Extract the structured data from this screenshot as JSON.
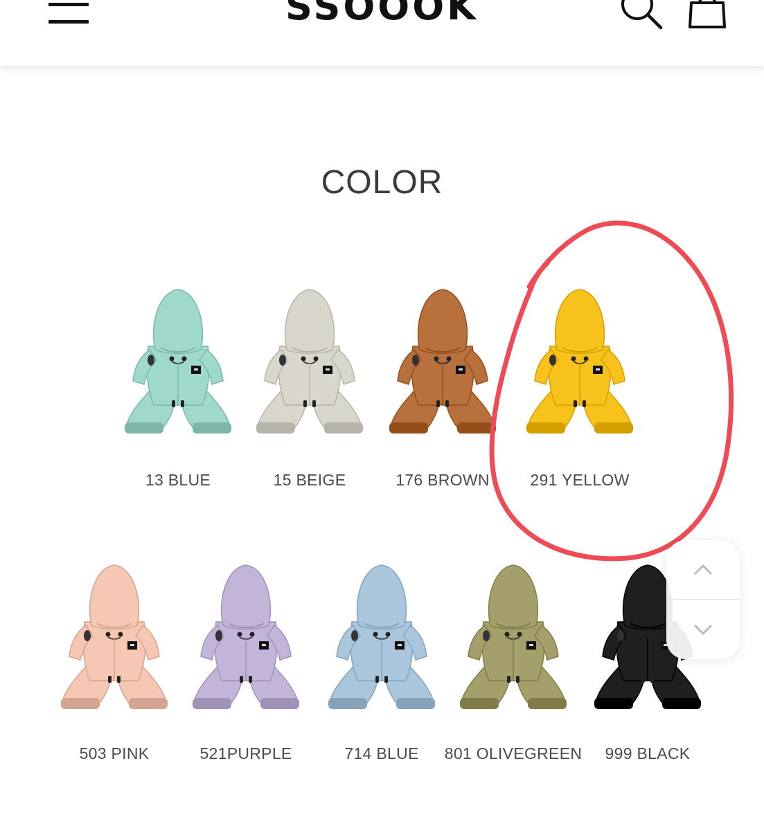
{
  "header": {
    "logo": "SSOOOK",
    "menu_icon": "hamburger-menu-icon",
    "search_icon": "search-icon",
    "cart_icon": "shopping-bag-icon"
  },
  "section": {
    "title": "COLOR"
  },
  "colors": [
    {
      "label": "13 BLUE",
      "hex": "#9fd9cb"
    },
    {
      "label": "15 BEIGE",
      "hex": "#d9d6cc"
    },
    {
      "label": "176 BROWN",
      "hex": "#b8703d"
    },
    {
      "label": "291 YELLOW",
      "hex": "#f7c21b"
    },
    {
      "label": "503 PINK",
      "hex": "#f6c7b2"
    },
    {
      "label": "521PURPLE",
      "hex": "#c3b4d9"
    },
    {
      "label": "714 BLUE",
      "hex": "#a9c6dd"
    },
    {
      "label": "801 OLIVEGREEN",
      "hex": "#a5a06b"
    },
    {
      "label": "999 BLACK",
      "hex": "#1f1f1f"
    }
  ],
  "annotation": {
    "color": "#ee4b55",
    "highlighted": "291 YELLOW"
  },
  "scroll": {
    "up_icon": "chevron-up-icon",
    "down_icon": "chevron-down-icon"
  }
}
